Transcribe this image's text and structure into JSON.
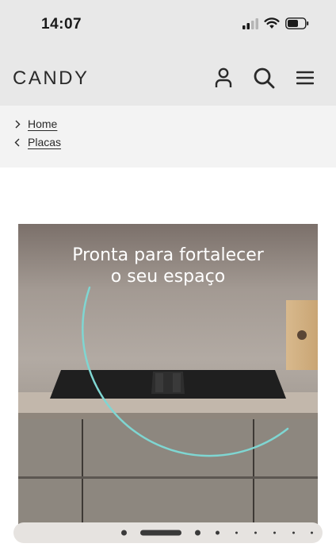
{
  "status_bar": {
    "time": "14:07",
    "icons": [
      "signal-icon",
      "wifi-icon",
      "battery-icon"
    ]
  },
  "header": {
    "brand": "CANDY",
    "actions": [
      "account-icon",
      "search-icon",
      "menu-icon"
    ]
  },
  "breadcrumb": {
    "items": [
      {
        "label": "Home"
      },
      {
        "label": "Placas"
      }
    ]
  },
  "hero": {
    "title_line1": "Pronta para fortalecer",
    "title_line2": "o seu espaço"
  },
  "carousel": {
    "slides": 8,
    "active": 2
  },
  "colors": {
    "header_bg": "#e8e8e8",
    "breadcrumb_bg": "#f3f3f3",
    "accent_arc": "#7fd6d2"
  }
}
